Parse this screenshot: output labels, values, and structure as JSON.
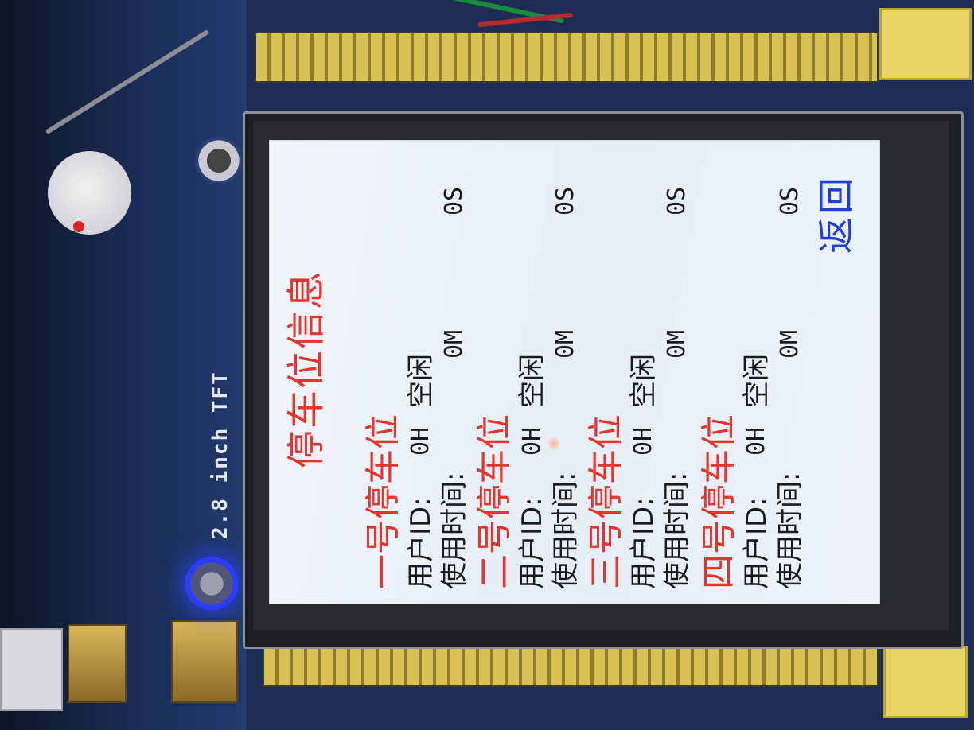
{
  "board": {
    "tft_label": "2.8 inch TFT"
  },
  "screen": {
    "title": "停车位信息",
    "slots": [
      {
        "name": "一号停车位",
        "user_label": "用户ID:",
        "user_id": "0H",
        "status": "空闲",
        "time_label": "使用时间:",
        "minutes": "0M",
        "seconds": "0S"
      },
      {
        "name": "二号停车位",
        "user_label": "用户ID:",
        "user_id": "0H",
        "status": "空闲",
        "time_label": "使用时间:",
        "minutes": "0M",
        "seconds": "0S"
      },
      {
        "name": "三号停车位",
        "user_label": "用户ID:",
        "user_id": "0H",
        "status": "空闲",
        "time_label": "使用时间:",
        "minutes": "0M",
        "seconds": "0S"
      },
      {
        "name": "四号停车位",
        "user_label": "用户ID:",
        "user_id": "0H",
        "status": "空闲",
        "time_label": "使用时间:",
        "minutes": "0M",
        "seconds": "0S"
      }
    ],
    "back_label": "返回"
  },
  "colors": {
    "title": "#e8352b",
    "slot_title": "#e8352b",
    "body_text": "#1a1a1a",
    "back_button": "#1f3fd8",
    "screen_bg": "#eef3fb"
  }
}
